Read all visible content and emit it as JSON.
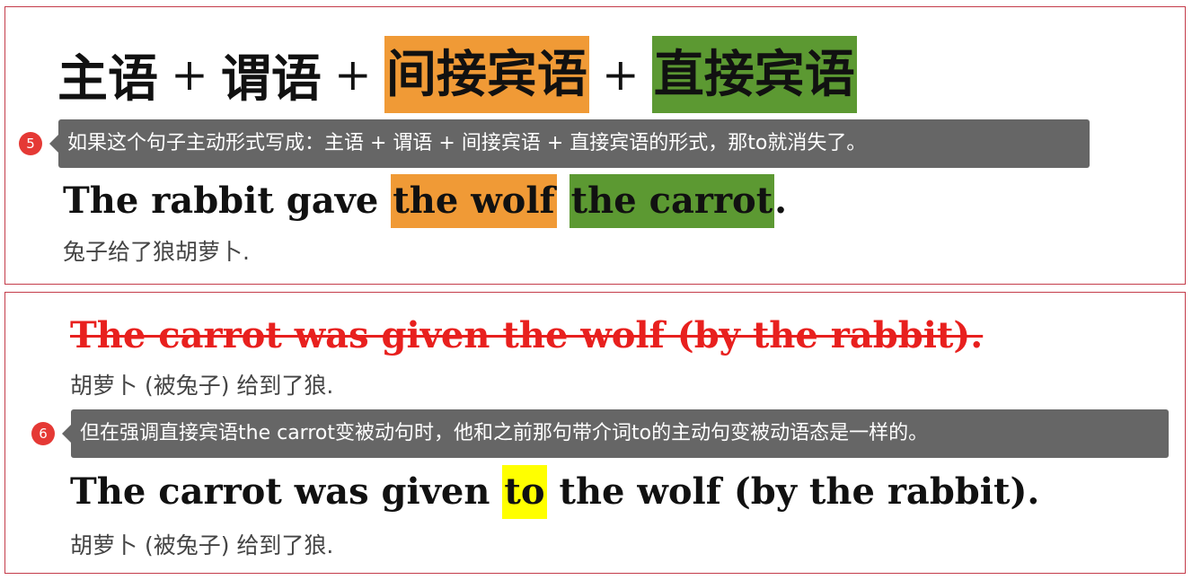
{
  "panel1": {
    "formula": {
      "subject": "主语",
      "plus": "+",
      "predicate": "谓语",
      "indirect_object": "间接宾语",
      "direct_object": "直接宾语"
    },
    "note_number": "5",
    "note_text": "如果这个句子主动形式写成：主语 + 谓语 + 间接宾语 + 直接宾语的形式，那to就消失了。",
    "sentence": {
      "part1": "The rabbit gave ",
      "part2": "the wolf",
      "part3": " ",
      "part4": "the carrot",
      "part5": "."
    },
    "translation": "兔子给了狼胡萝卜."
  },
  "panel2": {
    "wrong_sentence": "The carrot was given the wolf (by the rabbit).",
    "wrong_translation": "胡萝卜 (被兔子) 给到了狼.",
    "note_number": "6",
    "note_text": "但在强调直接宾语the carrot变被动句时，他和之前那句带介词to的主动句变被动语态是一样的。",
    "sentence": {
      "part1": "The carrot was given ",
      "part2": "to",
      "part3": " the wolf (by the rabbit)."
    },
    "translation": "胡萝卜 (被兔子) 给到了狼."
  },
  "colors": {
    "orange": "#f09a36",
    "green": "#5c9932",
    "yellow": "#ffff00",
    "strike_red": "#e8201e",
    "note_bg": "#666666",
    "badge_red": "#e53935",
    "border": "#c43c4a"
  }
}
